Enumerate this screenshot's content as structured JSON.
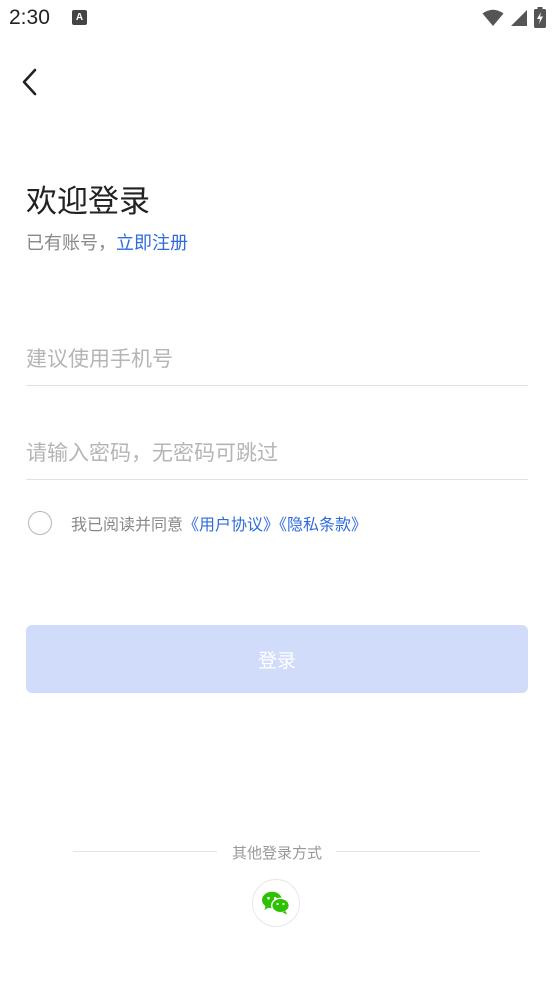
{
  "status_bar": {
    "time": "2:30",
    "notification_icon_letter": "A",
    "icons": [
      "wifi-icon",
      "signal-icon",
      "battery-charging-icon"
    ]
  },
  "header": {
    "back_icon": "chevron-left-icon"
  },
  "welcome": {
    "title": "欢迎登录",
    "subtitle_prefix": "已有账号，",
    "register_link": "立即注册"
  },
  "form": {
    "phone_placeholder": "建议使用手机号",
    "phone_value": "",
    "password_placeholder": "请输入密码，无密码可跳过",
    "password_value": ""
  },
  "agreement": {
    "checked": false,
    "prefix": "我已阅读并同意",
    "user_agreement": "《用户协议》",
    "privacy_policy": "《隐私条款》"
  },
  "login_button": {
    "label": "登录"
  },
  "other_login": {
    "label": "其他登录方式",
    "wechat_icon": "wechat-icon"
  },
  "colors": {
    "link": "#2f6bdd",
    "button_disabled": "#d0dcfa",
    "wechat": "#2dc100"
  }
}
